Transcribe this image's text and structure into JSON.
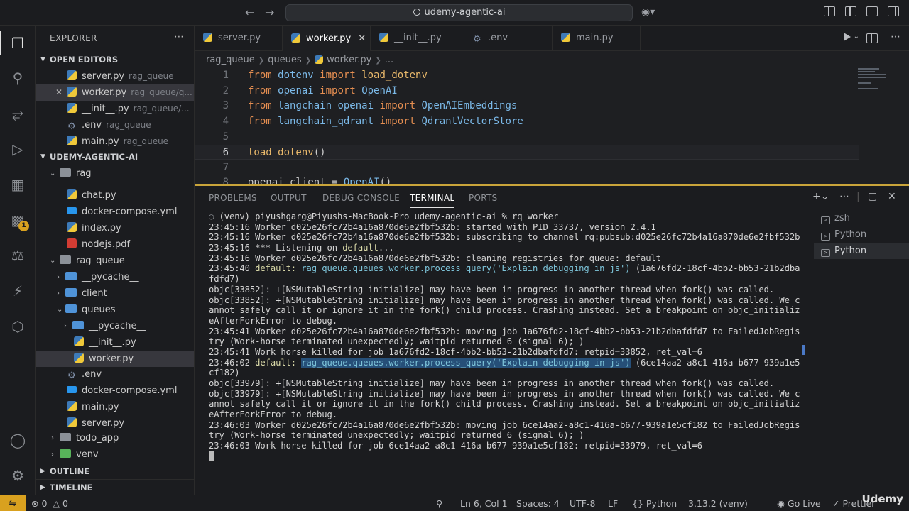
{
  "window": {
    "search_label": "udemy-agentic-ai"
  },
  "sidebar": {
    "title": "EXPLORER",
    "open_editors_label": "OPEN EDITORS",
    "open_editors": [
      {
        "name": "server.py",
        "path": "rag_queue"
      },
      {
        "name": "worker.py",
        "path": "rag_queue/q..."
      },
      {
        "name": "__init__.py",
        "path": "rag_queue/..."
      },
      {
        "name": ".env",
        "path": "rag_queue"
      },
      {
        "name": "main.py",
        "path": "rag_queue"
      }
    ],
    "project_label": "UDEMY-AGENTIC-AI",
    "tree": [
      {
        "name": "rag"
      },
      {
        "name": "chat.py"
      },
      {
        "name": "docker-compose.yml"
      },
      {
        "name": "index.py"
      },
      {
        "name": "nodejs.pdf"
      },
      {
        "name": "rag_queue"
      },
      {
        "name": "__pycache__"
      },
      {
        "name": "client"
      },
      {
        "name": "queues"
      },
      {
        "name": "__pycache__"
      },
      {
        "name": "__init__.py"
      },
      {
        "name": "worker.py"
      },
      {
        "name": ".env"
      },
      {
        "name": "docker-compose.yml"
      },
      {
        "name": "main.py"
      },
      {
        "name": "server.py"
      },
      {
        "name": "todo_app"
      },
      {
        "name": "venv"
      }
    ],
    "outline_label": "OUTLINE",
    "timeline_label": "TIMELINE",
    "extensions_badge": "1"
  },
  "tabs": [
    {
      "label": "server.py"
    },
    {
      "label": "worker.py"
    },
    {
      "label": "__init__.py"
    },
    {
      "label": ".env"
    },
    {
      "label": "main.py"
    }
  ],
  "breadcrumb": {
    "parts": [
      "rag_queue",
      "queues",
      "worker.py",
      "..."
    ]
  },
  "editor": {
    "line_numbers": [
      "1",
      "2",
      "3",
      "4",
      "5",
      "6",
      "7",
      "8"
    ]
  },
  "panel": {
    "tabs": [
      "PROBLEMS",
      "OUTPUT",
      "DEBUG CONSOLE",
      "TERMINAL",
      "PORTS"
    ],
    "terminal_lines": [
      "(venv) piyushgarg@Piyushs-MacBook-Pro udemy-agentic-ai % rq worker",
      "23:45:16 Worker d025e26fc72b4a16a870de6e2fbf532b: started with PID 33737, version 2.4.1",
      "23:45:16 Worker d025e26fc72b4a16a870de6e2fbf532b: subscribing to channel rq:pubsub:d025e26fc72b4a16a870de6e2fbf532b",
      "23:45:16 *** Listening on default...",
      "23:45:16 Worker d025e26fc72b4a16a870de6e2fbf532b: cleaning registries for queue: default",
      "23:45:40 default: rag_queue.queues.worker.process_query('Explain debugging in js') (1a676fd2-18cf-4bb2-bb53-21b2dba",
      "fdfd7)",
      "objc[33852]: +[NSMutableString initialize] may have been in progress in another thread when fork() was called.",
      "objc[33852]: +[NSMutableString initialize] may have been in progress in another thread when fork() was called. We c",
      "annot safely call it or ignore it in the fork() child process. Crashing instead. Set a breakpoint on objc_initializ",
      "eAfterForkError to debug.",
      "23:45:41 Worker d025e26fc72b4a16a870de6e2fbf532b: moving job 1a676fd2-18cf-4bb2-bb53-21b2dbafdfd7 to FailedJobRegis",
      "try (Work-horse terminated unexpectedly; waitpid returned 6 (signal 6); )",
      "23:45:41 Work horse killed for job 1a676fd2-18cf-4bb2-bb53-21b2dbafdfd7: retpid=33852, ret_val=6",
      "23:46:02 default: rag_queue.queues.worker.process_query('Explain debugging in js') (6ce14aa2-a8c1-416a-b677-939a1e5",
      "cf182)",
      "objc[33979]: +[NSMutableString initialize] may have been in progress in another thread when fork() was called.",
      "objc[33979]: +[NSMutableString initialize] may have been in progress in another thread when fork() was called. We c",
      "annot safely call it or ignore it in the fork() child process. Crashing instead. Set a breakpoint on objc_initializ",
      "eAfterForkError to debug.",
      "23:46:03 Worker d025e26fc72b4a16a870de6e2fbf532b: moving job 6ce14aa2-a8c1-416a-b677-939a1e5cf182 to FailedJobRegis",
      "try (Work-horse terminated unexpectedly; waitpid returned 6 (signal 6); )",
      "23:46:03 Work horse killed for job 6ce14aa2-a8c1-416a-b677-939a1e5cf182: retpid=33979, ret_val=6"
    ],
    "terminals": [
      "zsh",
      "Python",
      "Python"
    ]
  },
  "statusbar": {
    "errors": "0",
    "warnings": "0",
    "position": "Ln 6, Col 1",
    "spaces": "Spaces: 4",
    "encoding": "UTF-8",
    "eol": "LF",
    "language": "Python",
    "interpreter": "3.13.2 (venv)",
    "golive": "Go Live",
    "prettier": "Prettier"
  },
  "watermark": "Udemy",
  "colors": {
    "accent": "#4b79c6",
    "sash": "#c9a43a",
    "keyword": "#e58e51",
    "function": "#e8b86b",
    "module": "#7bb9e8"
  }
}
